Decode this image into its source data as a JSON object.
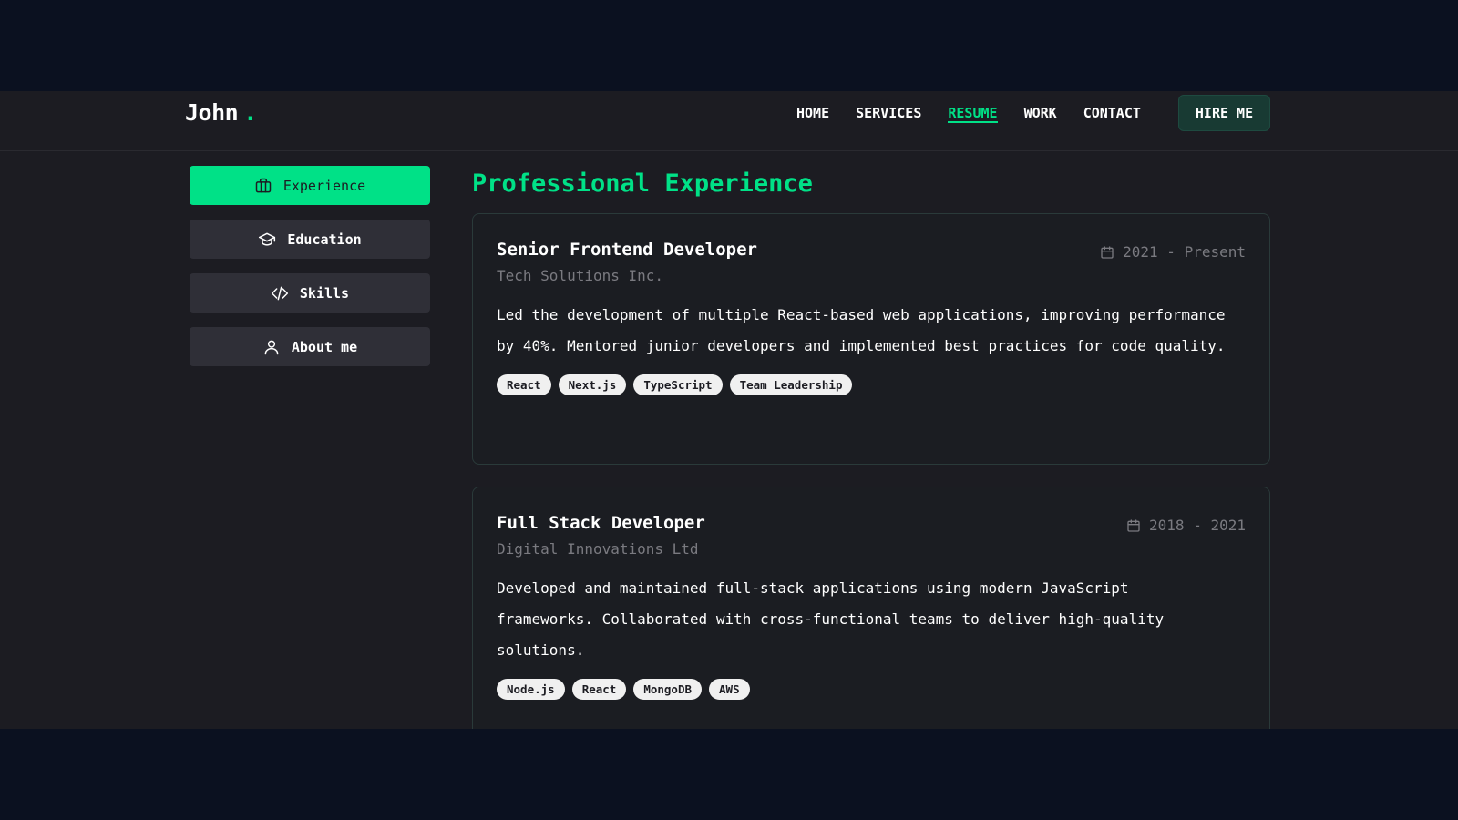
{
  "header": {
    "logo_text": "John",
    "logo_dot": ".",
    "nav": [
      {
        "label": "HOME"
      },
      {
        "label": "SERVICES"
      },
      {
        "label": "RESUME"
      },
      {
        "label": "WORK"
      },
      {
        "label": "CONTACT"
      }
    ],
    "active_nav": "RESUME",
    "hire_label": "HIRE ME"
  },
  "sidebar": {
    "items": [
      {
        "label": "Experience",
        "icon": "briefcase-icon"
      },
      {
        "label": "Education",
        "icon": "graduation-cap-icon"
      },
      {
        "label": "Skills",
        "icon": "code-icon"
      },
      {
        "label": "About me",
        "icon": "user-icon"
      }
    ],
    "active": "Experience"
  },
  "main": {
    "title": "Professional Experience",
    "experiences": [
      {
        "role": "Senior Frontend Developer",
        "company": "Tech Solutions Inc.",
        "date": "2021 - Present",
        "description": "Led the development of multiple React-based web applications, improving performance by 40%. Mentored junior developers and implemented best practices for code quality.",
        "tags": [
          "React",
          "Next.js",
          "TypeScript",
          "Team Leadership"
        ]
      },
      {
        "role": "Full Stack Developer",
        "company": "Digital Innovations Ltd",
        "date": "2018 - 2021",
        "description": "Developed and maintained full-stack applications using modern JavaScript frameworks. Collaborated with cross-functional teams to deliver high-quality solutions.",
        "tags": [
          "Node.js",
          "React",
          "MongoDB",
          "AWS"
        ]
      }
    ]
  },
  "colors": {
    "accent": "#00e187",
    "background": "#1c1c22",
    "outer_background": "#0b1120",
    "card": "#1b1d22",
    "button": "#2f2f37",
    "muted_text": "#7a7a80"
  }
}
